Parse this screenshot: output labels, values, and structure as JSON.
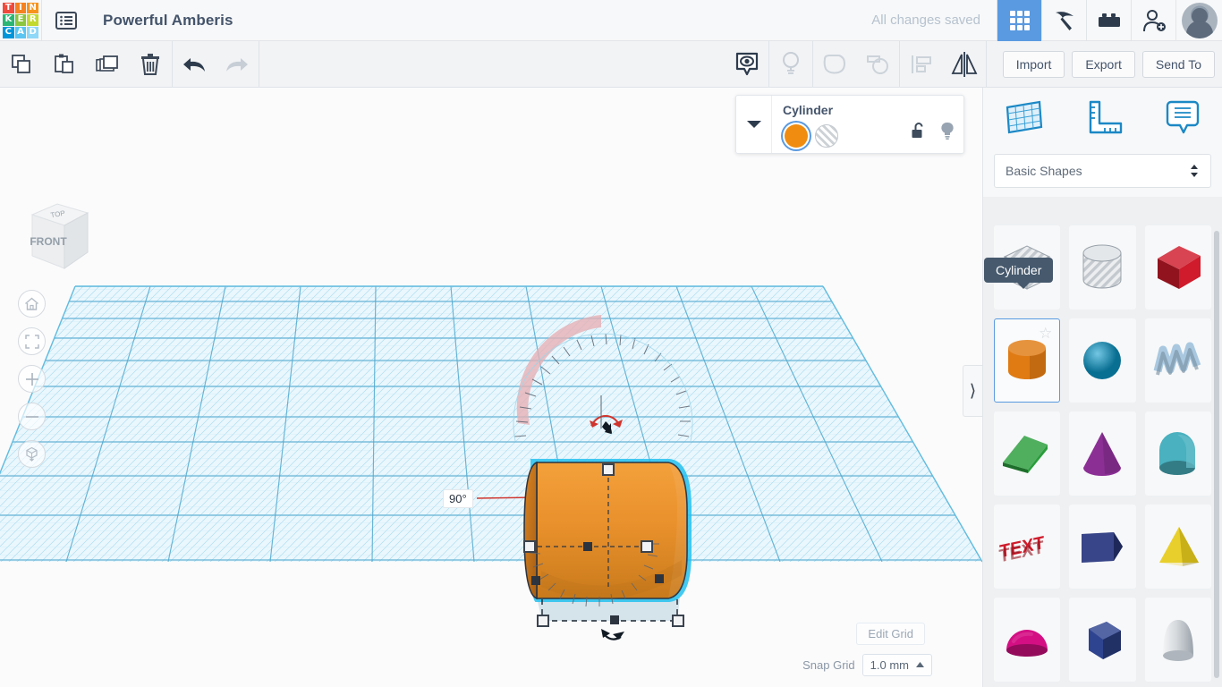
{
  "header": {
    "logo_letters": [
      {
        "ch": "T",
        "color": "#ef4a3c"
      },
      {
        "ch": "I",
        "color": "#f58220"
      },
      {
        "ch": "N",
        "color": "#f7941e"
      },
      {
        "ch": "K",
        "color": "#2bb673"
      },
      {
        "ch": "E",
        "color": "#8dc63f"
      },
      {
        "ch": "R",
        "color": "#c4d92e"
      },
      {
        "ch": "C",
        "color": "#0095da"
      },
      {
        "ch": "A",
        "color": "#5bc5f2"
      },
      {
        "ch": "D",
        "color": "#8ed8f8"
      }
    ],
    "design_title": "Powerful Amberis",
    "save_status": "All changes saved",
    "menu_icon": "list-menu-icon",
    "buttons": [
      {
        "name": "blocks-view-button",
        "icon": "grid-blocks-icon",
        "active": true
      },
      {
        "name": "codeblocks-button",
        "icon": "pickaxe-icon",
        "active": false
      },
      {
        "name": "bricks-button",
        "icon": "lego-brick-icon",
        "active": false
      },
      {
        "name": "invite-people-button",
        "icon": "person-add-icon",
        "active": false
      }
    ],
    "avatar_name": "user-avatar"
  },
  "toolbar": {
    "left_tools": [
      {
        "name": "copy-button",
        "icon": "copy-icon"
      },
      {
        "name": "paste-button",
        "icon": "clipboard-paste-icon"
      },
      {
        "name": "duplicate-button",
        "icon": "duplicate-icon"
      },
      {
        "name": "delete-button",
        "icon": "trash-icon"
      }
    ],
    "history_tools": [
      {
        "name": "undo-button",
        "icon": "undo-arrow-icon",
        "enabled": true
      },
      {
        "name": "redo-button",
        "icon": "redo-arrow-icon",
        "enabled": false
      }
    ],
    "center_tools": [
      {
        "name": "show-hide-button",
        "icon": "eye-marker-icon",
        "enabled": true
      },
      {
        "name": "light-button",
        "icon": "lightbulb-icon",
        "enabled": false
      },
      {
        "name": "group-button",
        "icon": "group-shapes-icon",
        "enabled": false
      },
      {
        "name": "ungroup-button",
        "icon": "ungroup-shapes-icon",
        "enabled": false
      },
      {
        "name": "align-button",
        "icon": "align-icon",
        "enabled": false
      },
      {
        "name": "mirror-button",
        "icon": "mirror-flip-icon",
        "enabled": true
      }
    ],
    "import_label": "Import",
    "export_label": "Export",
    "send_to_label": "Send To"
  },
  "shape_panel": {
    "caret_icon": "chevron-down-icon",
    "title": "Cylinder",
    "swatches": [
      {
        "name": "solid-color-swatch",
        "label": "Solid",
        "color": "#f08c10",
        "selected": true
      },
      {
        "name": "hole-swatch",
        "label": "Hole",
        "color": "#d5d9dd",
        "selected": false
      }
    ],
    "lock_icon": "unlock-icon",
    "light_icon": "lightbulb-icon"
  },
  "viewport": {
    "navcube_top_label": "TOP",
    "navcube_front_label": "FRONT",
    "nav_buttons": [
      {
        "name": "home-view-button",
        "icon": "home-icon"
      },
      {
        "name": "fit-view-button",
        "icon": "fit-all-icon"
      },
      {
        "name": "zoom-in-button",
        "icon": "plus-icon"
      },
      {
        "name": "zoom-out-button",
        "icon": "minus-icon"
      },
      {
        "name": "ortho-perspective-button",
        "icon": "cube-perspective-icon"
      }
    ],
    "rotation_label": "90°",
    "edit_grid_label": "Edit Grid",
    "snap_grid_label": "Snap Grid",
    "snap_grid_value": "1.0 mm",
    "snap_caret_icon": "caret-up-icon",
    "collapse_icon": "chevron-right-icon",
    "object_color": "#e08b2a",
    "selection_color": "#23b8e8",
    "grid_color": "#45b6e0"
  },
  "sidebar": {
    "tabs": [
      {
        "name": "tab-workplane",
        "icon": "workplane-grid-icon"
      },
      {
        "name": "tab-ruler",
        "icon": "ruler-icon"
      },
      {
        "name": "tab-notes",
        "icon": "note-bubble-icon"
      }
    ],
    "category_label": "Basic Shapes",
    "category_caret_icon": "updown-caret-icon",
    "tooltip_text": "Cylinder",
    "shapes": [
      {
        "name": "shape-box-hole",
        "label": "Box Hole",
        "kind": "hatch-box",
        "color": "#cfd4d8",
        "selected": false,
        "starred": false
      },
      {
        "name": "shape-cylinder-hole",
        "label": "Cylinder Hole",
        "kind": "hatch-cyl",
        "color": "#cfd4d8",
        "selected": false,
        "starred": false
      },
      {
        "name": "shape-box",
        "label": "Box",
        "kind": "box",
        "color": "#cf1b2b",
        "selected": false,
        "starred": false
      },
      {
        "name": "shape-cylinder",
        "label": "Cylinder",
        "kind": "cyl",
        "color": "#e07b14",
        "selected": true,
        "starred": true
      },
      {
        "name": "shape-sphere",
        "label": "Sphere",
        "kind": "sphere",
        "color": "#0d9fd0",
        "selected": false,
        "starred": false
      },
      {
        "name": "shape-scribble",
        "label": "Scribble",
        "kind": "scribble",
        "color": "#a9c8e0",
        "selected": false,
        "starred": false
      },
      {
        "name": "shape-roof",
        "label": "Roof",
        "kind": "roof",
        "color": "#2a9d3c",
        "selected": false,
        "starred": false
      },
      {
        "name": "shape-cone",
        "label": "Cone",
        "kind": "cone",
        "color": "#8b2f95",
        "selected": false,
        "starred": false
      },
      {
        "name": "shape-round-roof",
        "label": "Round Roof",
        "kind": "roundroof",
        "color": "#49b1bf",
        "selected": false,
        "starred": false
      },
      {
        "name": "shape-text",
        "label": "Text",
        "kind": "text",
        "color": "#cf1b2b",
        "selected": false,
        "starred": false
      },
      {
        "name": "shape-wedge",
        "label": "Wedge",
        "kind": "wedge",
        "color": "#2b3a80",
        "selected": false,
        "starred": false
      },
      {
        "name": "shape-pyramid",
        "label": "Pyramid",
        "kind": "pyramid",
        "color": "#e8cc1e",
        "selected": false,
        "starred": false
      },
      {
        "name": "shape-half-sphere",
        "label": "Half Sphere",
        "kind": "halfsphere",
        "color": "#d40f84",
        "selected": false,
        "starred": false
      },
      {
        "name": "shape-polygon",
        "label": "Polygon",
        "kind": "polygon",
        "color": "#2f4490",
        "selected": false,
        "starred": false
      },
      {
        "name": "shape-paraboloid",
        "label": "Paraboloid",
        "kind": "paraboloid",
        "color": "#c8ccd0",
        "selected": false,
        "starred": false
      }
    ]
  }
}
